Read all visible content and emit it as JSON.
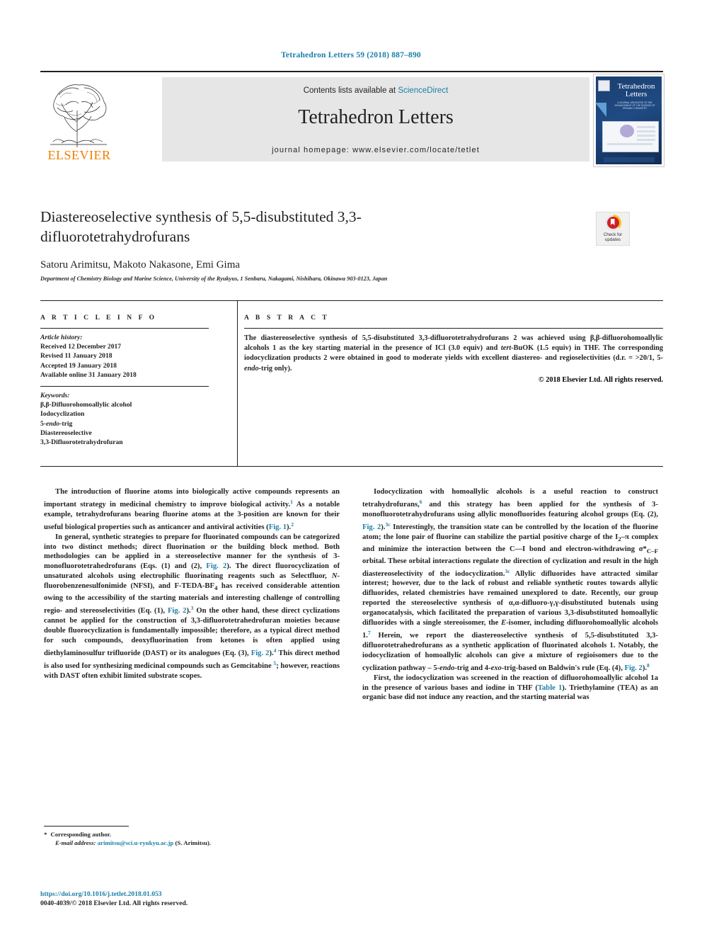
{
  "running_head": "Tetrahedron Letters 59 (2018) 887–890",
  "masthead": {
    "contents_prefix": "Contents lists available at ",
    "sciencedirect": "ScienceDirect",
    "journal": "Tetrahedron Letters",
    "homepage": "journal homepage: www.elsevier.com/locate/tetlet",
    "publisher_logo_word": "ELSEVIER",
    "cover_title": "Tetrahedron Letters",
    "cover_subtitle": "A JOURNAL DEDICATED TO THE ADVANCEMENT OF THE SCIENCE OF ORGANIC CHEMISTRY"
  },
  "crossmark": {
    "line1": "Check for",
    "line2": "updates"
  },
  "title": "Diastereoselective synthesis of 5,5-disubstituted 3,3-difluorotetrahydrofurans",
  "authors": "Satoru Arimitsu, Makoto Nakasone, Emi Gima",
  "corresponding_marker": "*",
  "affiliation": "Department of Chemistry Biology and Marine Science, University of the Ryukyus, 1 Senbaru, Nakagami, Nishihara, Okinawa 903-0123, Japan",
  "article_info": {
    "heading": "A R T I C L E   I N F O",
    "history_label": "Article history:",
    "history": [
      "Received 12 December 2017",
      "Revised 11 January 2018",
      "Accepted 19 January 2018",
      "Available online 31 January 2018"
    ],
    "keywords_label": "Keywords:",
    "keywords": [
      "β,β-Difluorohomoallylic alcohol",
      "Iodocyclization",
      "5-endo-trig",
      "Diastereoselective",
      "3,3-Difluorotetrahydrofuran"
    ]
  },
  "abstract": {
    "heading": "A B S T R A C T",
    "text": "The diastereoselective synthesis of 5,5-disubstituted 3,3-difluorotetrahydrofurans 2 was achieved using β,β-difluorohomoallylic alcohols 1 as the key starting material in the presence of ICl (3.0 equiv) and tert-BuOK (1.5 equiv) in THF. The corresponding iodocyclization products 2 were obtained in good to moderate yields with excellent diastereo- and regioselectivities (d.r. = >20/1, 5-endo-trig only).",
    "copyright": "© 2018 Elsevier Ltd. All rights reserved."
  },
  "body": {
    "left": [
      "The introduction of fluorine atoms into biologically active compounds represents an important strategy in medicinal chemistry to improve biological activity.1 As a notable example, tetrahydrofurans bearing fluorine atoms at the 3-position are known for their useful biological properties such as anticancer and antiviral activities (Fig. 1).2",
      "In general, synthetic strategies to prepare for fluorinated compounds can be categorized into two distinct methods; direct fluorination or the building block method. Both methodologies can be applied in a stereoselective manner for the synthesis of 3-monofluorotetrahedrofurans (Eqs. (1) and (2), Fig. 2). The direct fluorocyclization of unsaturated alcohols using electrophilic fluorinating reagents such as Selectfluor, N-fluorobenzenesulfonimide (NFSI), and F-TEDA-BF4 has received considerable attention owing to the accessibility of the starting materials and interesting challenge of controlling regio- and stereoselectivities (Eq. (1), Fig. 2).3 On the other hand, these direct cyclizations cannot be applied for the construction of 3,3-difluorotetrahedrofuran moieties because double fluorocyclization is fundamentally impossible; therefore, as a typical direct method for such compounds, deoxyfluorination from ketones is often applied using diethylaminosulfur trifluoride (DAST) or its analogues (Eq. (3), Fig. 2).4 This direct method is also used for synthesizing medicinal compounds such as Gemcitabine 5; however, reactions with DAST often exhibit limited substrate scopes."
    ],
    "right": [
      "Iodocyclization with homoallylic alcohols is a useful reaction to construct tetrahydrofurans,6 and this strategy has been applied for the synthesis of 3-monofluorotetrahydrofurans using allylic monofluorides featuring alcohol groups (Eq. (2), Fig. 2).3c Interestingly, the transition state can be controlled by the location of the fluorine atom; the lone pair of fluorine can stabilize the partial positive charge of the I2–π complex and minimize the interaction between the C—I bond and electron-withdrawing σ*C–F orbital. These orbital interactions regulate the direction of cyclization and result in the high diastereoselectivity of the iodocyclization.3c Allylic difluorides have attracted similar interest; however, due to the lack of robust and reliable synthetic routes towards allylic difluorides, related chemistries have remained unexplored to date. Recently, our group reported the stereoselective synthesis of α,α-difluoro-γ,γ-disubstituted butenals using organocatalysis, which facilitated the preparation of various 3,3-disubstituted homoallylic difluorides with a single stereoisomer, the E-isomer, including difluorohomoallylic alcohols 1.7 Herein, we report the diastereoselective synthesis of 5,5-disubstituted 3,3-difluorotetrahedrofurans as a synthetic application of fluorinated alcohols 1. Notably, the iodocyclization of homoallylic alcohols can give a mixture of regioisomers due to the cyclization pathway – 5-endo-trig and 4-exo-trig-based on Baldwin's rule (Eq. (4), Fig. 2).8",
      "First, the iodocyclization was screened in the reaction of difluorohomoallylic alcohol 1a in the presence of various bases and iodine in THF (Table 1). Triethylamine (TEA) as an organic base did not induce any reaction, and the starting material was"
    ]
  },
  "footnote": {
    "star": "*",
    "corresponding": "Corresponding author.",
    "email_label": "E-mail address:",
    "email": "arimitsu@sci.u-ryukyu.ac.jp",
    "email_suffix": "(S. Arimitsu)."
  },
  "doi": "https://doi.org/10.1016/j.tetlet.2018.01.053",
  "issn_line": "0040-4039/© 2018 Elsevier Ltd. All rights reserved.",
  "colors": {
    "link": "#1a7fa8",
    "elsevier_orange": "#f07d00",
    "band": "#e6e6e6"
  }
}
